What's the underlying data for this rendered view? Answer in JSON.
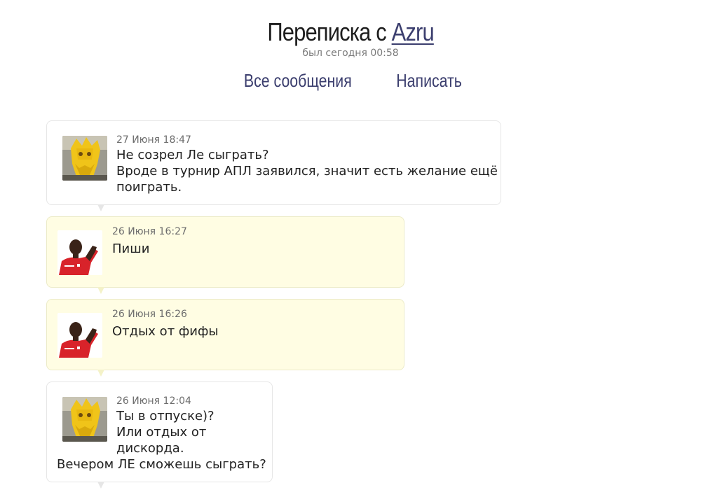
{
  "header": {
    "title_prefix": "Переписка с",
    "user_name": "Azru",
    "last_seen": "был сегодня 00:58"
  },
  "nav": {
    "all_messages": "Все сообщения",
    "write": "Написать"
  },
  "messages": [
    {
      "date": "27 Июня 18:47",
      "lines": [
        "Не созрел Ле сыграть?",
        "Вроде в турнир АПЛ заявился, значит есть желание ещё",
        "поиграть."
      ],
      "avatar": "yellow-mask-avatar"
    },
    {
      "date": "26 Июня 16:27",
      "lines": [
        "Пиши"
      ],
      "avatar": "footballer-avatar"
    },
    {
      "date": "26 Июня 16:26",
      "lines": [
        "Отдых от фифы"
      ],
      "avatar": "footballer-avatar"
    },
    {
      "date": "26 Июня 12:04",
      "lines": [
        "Ты в отпуске)?",
        "Или отдых от",
        "дискорда.",
        "Вечером ЛЕ сможешь сыграть?"
      ],
      "avatar": "yellow-mask-avatar"
    }
  ]
}
